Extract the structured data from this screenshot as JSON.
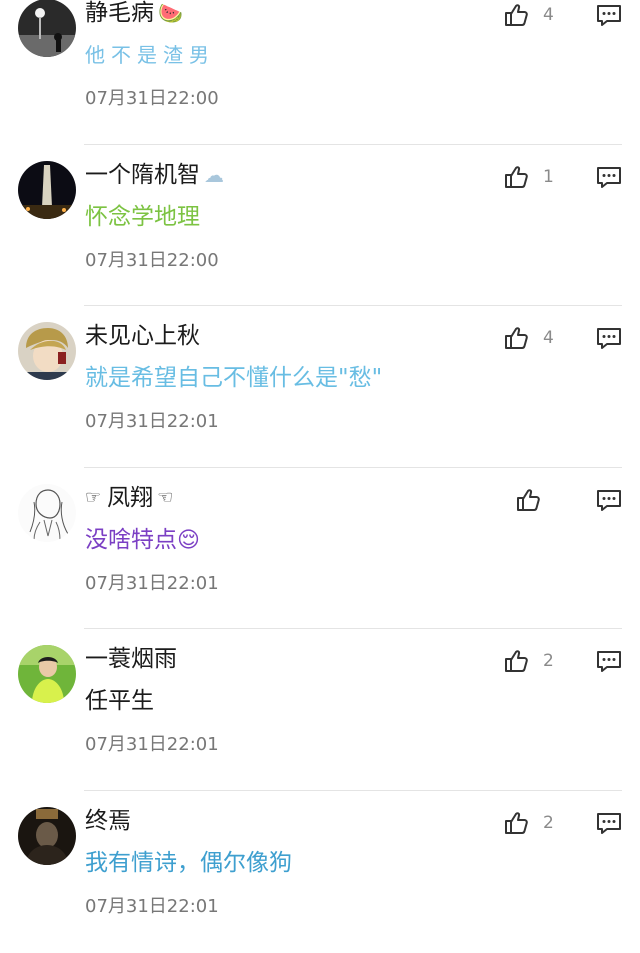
{
  "comments": [
    {
      "username": "静毛病",
      "username_decoration": "🍉",
      "text": "他不是渣男",
      "text_color": "#79c1e6",
      "time": "07月31日22:00",
      "likes": "4",
      "avatar": "night-street-avatar"
    },
    {
      "username": "一个隋机智",
      "username_decoration": "☁",
      "text": "怀念学地理",
      "text_color": "#7cc342",
      "time": "07月31日22:00",
      "likes": "1",
      "avatar": "city-tower-avatar"
    },
    {
      "username": "未见心上秋",
      "username_decoration": "",
      "text": "就是希望自己不懂什么是\"愁\"",
      "text_color": "#68bde3",
      "time": "07月31日22:01",
      "likes": "4",
      "avatar": "anime-boy-avatar"
    },
    {
      "username": "凤翔",
      "username_prefix": "☞",
      "username_decoration": "☜",
      "text": "没啥特点",
      "text_emoji": "😌",
      "text_color": "#7b3fc4",
      "time": "07月31日22:01",
      "likes": "",
      "avatar": "sketch-figure-avatar"
    },
    {
      "username": "一蓑烟雨",
      "username_decoration": "",
      "text": "任平生",
      "text_color": "#1b1b1b",
      "time": "07月31日22:01",
      "likes": "2",
      "avatar": "green-field-avatar"
    },
    {
      "username": "终焉",
      "username_decoration": "",
      "text": "我有情诗，偶尔像狗",
      "text_color": "#3e9fcf",
      "time": "07月31日22:01",
      "likes": "2",
      "avatar": "dark-portrait-avatar"
    }
  ]
}
